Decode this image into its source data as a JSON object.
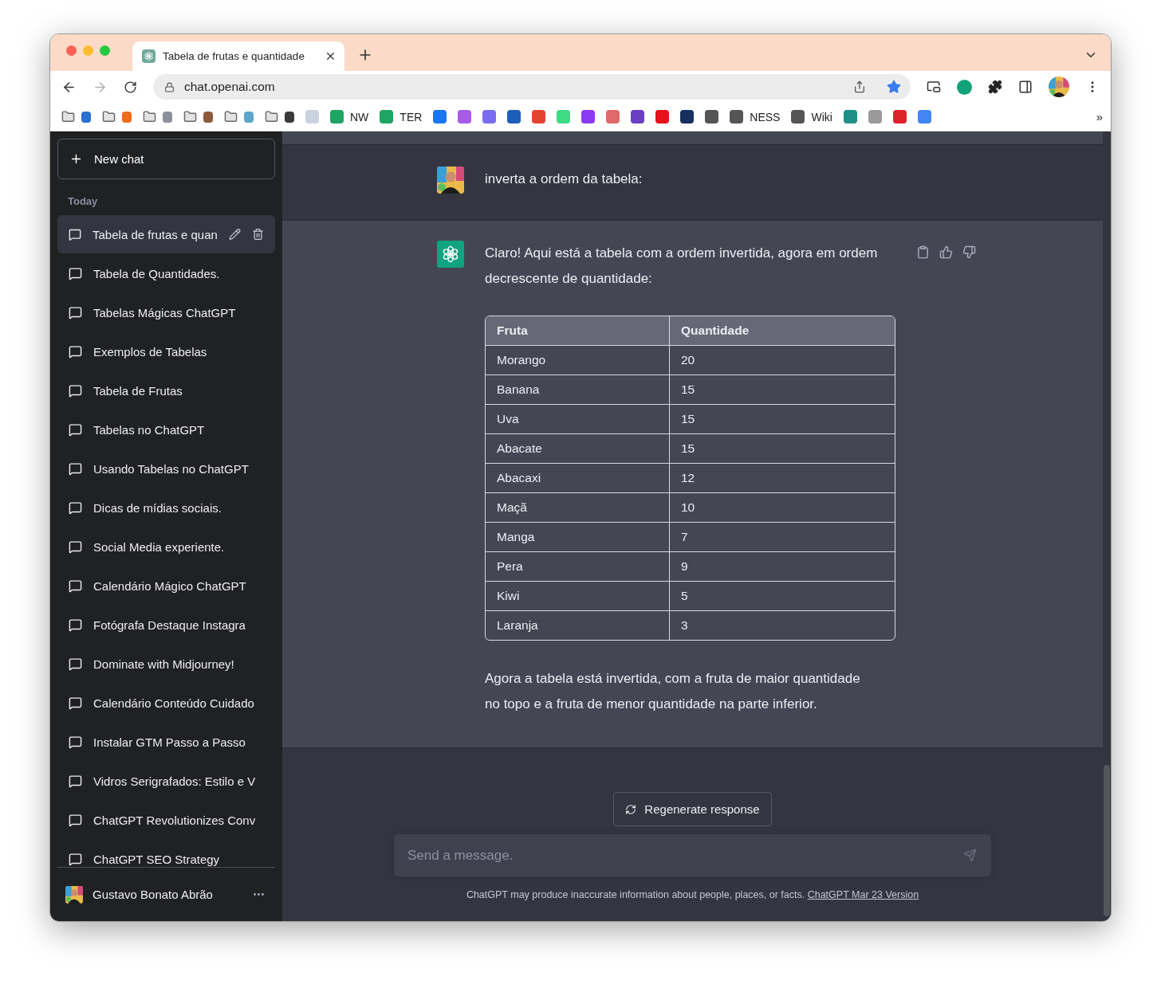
{
  "browser": {
    "tabs": [
      {
        "title": "Tabela de frutas e quantidade",
        "selected": true
      }
    ],
    "nav": {
      "back_disabled": false,
      "forward_disabled": true
    },
    "address": "chat.openai.com",
    "bookmarked": true,
    "bookmarks": [
      {
        "kind": "folder",
        "color": "#2a6fd1"
      },
      {
        "kind": "folder",
        "color": "#f26a1b"
      },
      {
        "kind": "folder",
        "color": "#8a8f99"
      },
      {
        "kind": "folder",
        "color": "#8b5a3c"
      },
      {
        "kind": "folder",
        "color": "#5aa6c8"
      },
      {
        "kind": "folder",
        "color": "#3a3a3a"
      },
      {
        "kind": "site",
        "color": "#c9d3e0"
      },
      {
        "kind": "site",
        "color": "#1fa463",
        "label": "NW"
      },
      {
        "kind": "site",
        "color": "#1fa463",
        "label": "TER"
      },
      {
        "kind": "site",
        "color": "#1877f2"
      },
      {
        "kind": "site",
        "color": "#a75ce8"
      },
      {
        "kind": "site",
        "color": "#7a6cf0"
      },
      {
        "kind": "site",
        "color": "#1d5fb8"
      },
      {
        "kind": "site",
        "color": "#e2452f"
      },
      {
        "kind": "site",
        "color": "#3ddc84"
      },
      {
        "kind": "site",
        "color": "#8b3cf2"
      },
      {
        "kind": "site",
        "color": "#e06a6a"
      },
      {
        "kind": "site",
        "color": "#6a3fc1"
      },
      {
        "kind": "site",
        "color": "#e8101a"
      },
      {
        "kind": "site",
        "color": "#15305f"
      },
      {
        "kind": "site",
        "color": "#555555"
      },
      {
        "kind": "site",
        "color": "#555555",
        "label": "NESS"
      },
      {
        "kind": "site",
        "color": "#555555",
        "label": "Wiki"
      },
      {
        "kind": "site",
        "color": "#1f8f86"
      },
      {
        "kind": "site",
        "color": "#9a9a9a"
      },
      {
        "kind": "site",
        "color": "#e0202a"
      },
      {
        "kind": "site",
        "color": "#4285f4"
      }
    ],
    "bookmarks_more": "»"
  },
  "sidebar": {
    "new_chat": "New chat",
    "section": "Today",
    "chats": [
      {
        "title": "Tabela de frutas e quan",
        "selected": true
      },
      {
        "title": "Tabela de Quantidades.",
        "selected": false
      },
      {
        "title": "Tabelas Mágicas ChatGPT",
        "selected": false
      },
      {
        "title": "Exemplos de Tabelas",
        "selected": false
      },
      {
        "title": "Tabela de Frutas",
        "selected": false
      },
      {
        "title": "Tabelas no ChatGPT",
        "selected": false
      },
      {
        "title": "Usando Tabelas no ChatGPT",
        "selected": false
      },
      {
        "title": "Dicas de mídias sociais.",
        "selected": false
      },
      {
        "title": "Social Media experiente.",
        "selected": false
      },
      {
        "title": "Calendário Mágico ChatGPT",
        "selected": false
      },
      {
        "title": "Fotógrafa Destaque Instagra",
        "selected": false
      },
      {
        "title": "Dominate with Midjourney!",
        "selected": false
      },
      {
        "title": "Calendário Conteúdo Cuidado",
        "selected": false
      },
      {
        "title": "Instalar GTM Passo a Passo",
        "selected": false
      },
      {
        "title": "Vidros Serigrafados: Estilo e V",
        "selected": false
      },
      {
        "title": "ChatGPT Revolutionizes Conv",
        "selected": false
      },
      {
        "title": "ChatGPT SEO Strategy",
        "selected": false
      }
    ],
    "user": {
      "name": "Gustavo Bonato Abrão"
    }
  },
  "conversation": {
    "messages": [
      {
        "kind": "user",
        "text": "inverta a ordem da tabela:"
      },
      {
        "kind": "assistant",
        "intro": "Claro! Aqui está a tabela com a ordem invertida, agora em ordem decrescente de quantidade:",
        "table": {
          "columns": [
            "Fruta",
            "Quantidade"
          ],
          "rows": [
            [
              "Morango",
              "20"
            ],
            [
              "Banana",
              "15"
            ],
            [
              "Uva",
              "15"
            ],
            [
              "Abacate",
              "15"
            ],
            [
              "Abacaxi",
              "12"
            ],
            [
              "Maçã",
              "10"
            ],
            [
              "Manga",
              "7"
            ],
            [
              "Pera",
              "9"
            ],
            [
              "Kiwi",
              "5"
            ],
            [
              "Laranja",
              "3"
            ]
          ]
        },
        "outro": "Agora a tabela está invertida, com a fruta de maior quantidade no topo e a fruta de menor quantidade na parte inferior."
      }
    ]
  },
  "composer": {
    "regenerate": "Regenerate response",
    "placeholder": "Send a message.",
    "disclaimer": "ChatGPT may produce inaccurate information about people, places, or facts.",
    "version_link": "ChatGPT Mar 23 Version"
  }
}
